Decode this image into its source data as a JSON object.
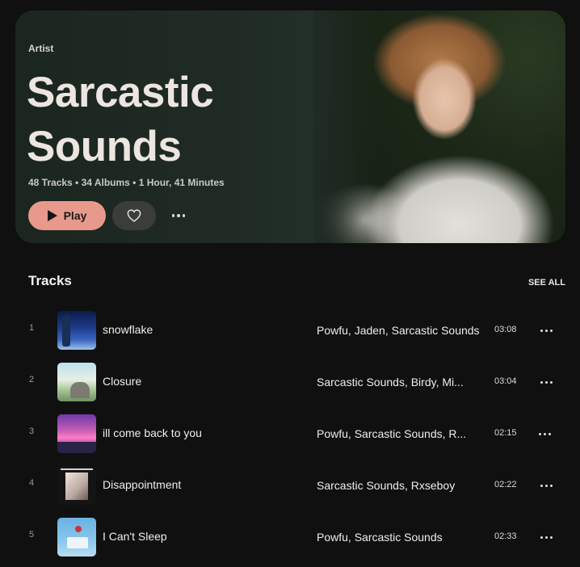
{
  "artist": {
    "label": "Artist",
    "name": "Sarcastic Sounds",
    "meta": "48 Tracks • 34 Albums • 1 Hour, 41 Minutes",
    "play_label": "Play"
  },
  "tracks_section": {
    "title": "Tracks",
    "see_all": "SEE ALL"
  },
  "tracks": [
    {
      "num": "1",
      "title": "snowflake",
      "artists": "Powfu, Jaden, Sarcastic Sounds",
      "duration": "03:08"
    },
    {
      "num": "2",
      "title": "Closure",
      "artists": "Sarcastic Sounds, Birdy, Mi...",
      "duration": "03:04"
    },
    {
      "num": "3",
      "title": "ill come back to you",
      "artists": "Powfu, Sarcastic Sounds, R...",
      "duration": "02:15"
    },
    {
      "num": "4",
      "title": "Disappointment",
      "artists": "Sarcastic Sounds, Rxseboy",
      "duration": "02:22"
    },
    {
      "num": "5",
      "title": "I Can't Sleep",
      "artists": "Powfu, Sarcastic Sounds",
      "duration": "02:33"
    }
  ],
  "colors": {
    "accent": "#e79a8c",
    "background": "#101010",
    "hero_bg": "#1f2b24"
  },
  "icons": {
    "play": "play-icon",
    "heart": "heart-icon",
    "more": "more-horizontal-icon"
  }
}
